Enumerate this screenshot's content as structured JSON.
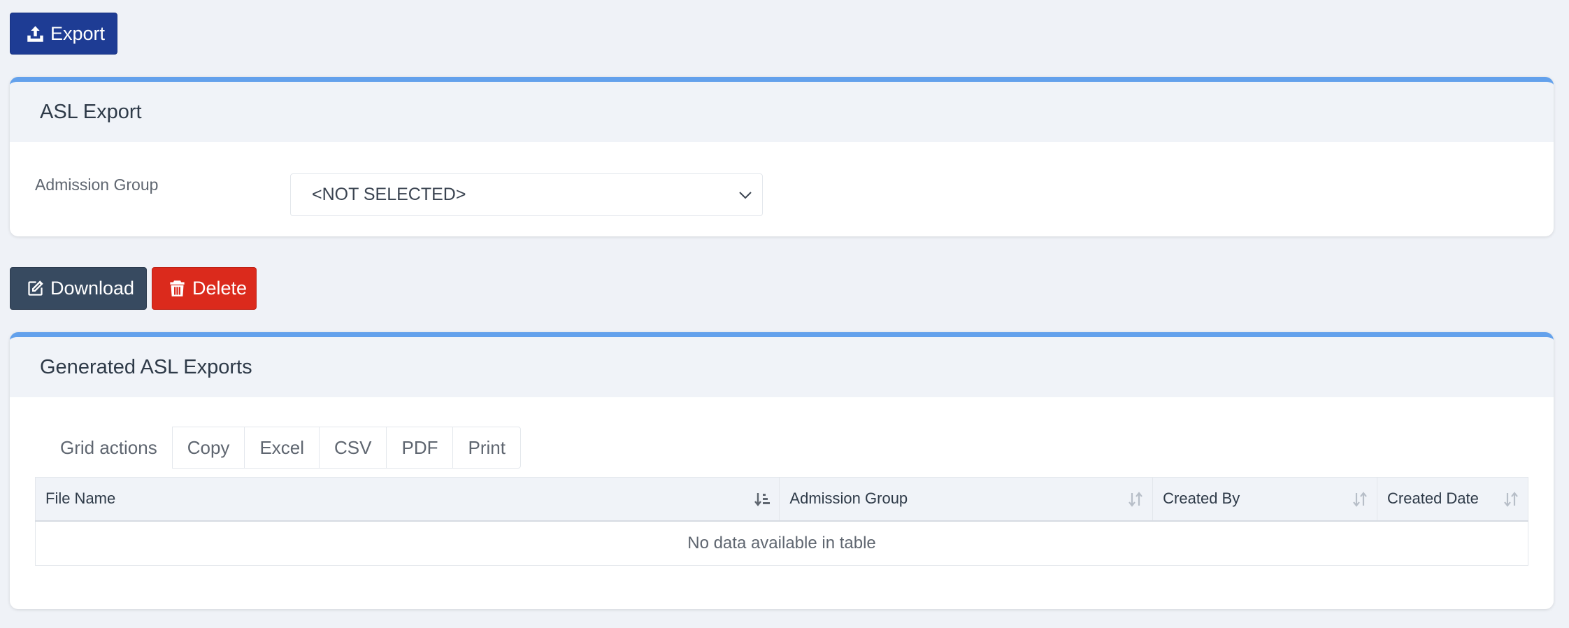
{
  "toolbar": {
    "export_label": "Export",
    "download_label": "Download",
    "delete_label": "Delete"
  },
  "asl_export": {
    "title": "ASL Export",
    "admission_group_label": "Admission Group",
    "admission_group_value": "<NOT SELECTED>"
  },
  "generated": {
    "title": "Generated ASL Exports",
    "grid_actions_label": "Grid actions",
    "grid_actions": [
      "Copy",
      "Excel",
      "CSV",
      "PDF",
      "Print"
    ],
    "columns": [
      "File Name",
      "Admission Group",
      "Created By",
      "Created Date"
    ],
    "empty_message": "No data available in table"
  },
  "colors": {
    "export_button": "#1e3c94",
    "download_button": "#374a60",
    "delete_button": "#db2a1c",
    "panel_accent": "#63a1ec"
  },
  "icons": {
    "export": "upload-icon",
    "download": "edit-icon",
    "delete": "trash-icon",
    "select": "chevron-down-icon",
    "sort": "sort-icon"
  }
}
